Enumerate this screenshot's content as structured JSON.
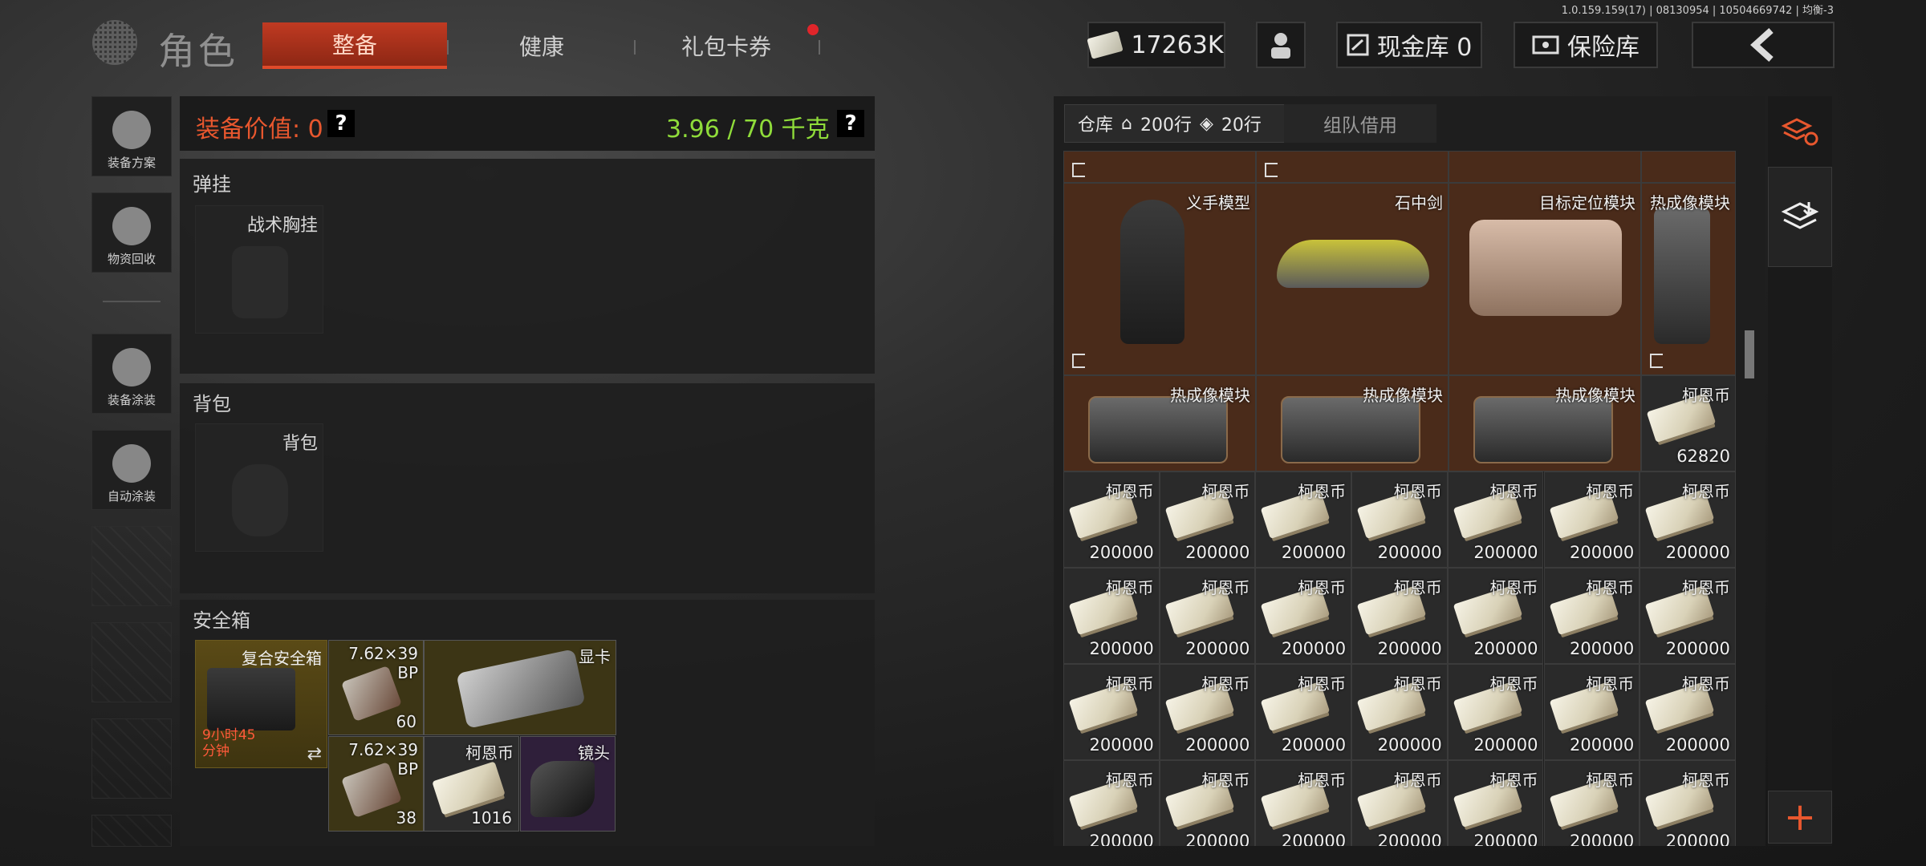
{
  "version": "1.0.159.159(17) | 08130954 | 10504669742 | 均衡-3",
  "title": "角色",
  "tabs": {
    "gear": "整备",
    "health": "健康",
    "gift": "礼包卡券"
  },
  "top": {
    "currency": "17263K",
    "cash_vault": "现金库 0",
    "insurance": "保险库"
  },
  "sidebar": {
    "loadout": "装备方案",
    "recycle": "物资回收",
    "skin": "装备涂装",
    "autopaint": "自动涂装"
  },
  "equip": {
    "value_label": "装备价值: 0",
    "weight": "3.96 / 70 千克",
    "help": "?"
  },
  "sections": {
    "rig": {
      "title": "弹挂",
      "slot": "战术胸挂"
    },
    "backpack": {
      "title": "背包",
      "slot": "背包"
    },
    "safebox": {
      "title": "安全箱",
      "box_name": "复合安全箱",
      "timer": "9小时45分钟",
      "items": [
        {
          "name": "7.62×39 BP",
          "count": "60"
        },
        {
          "name": "显卡",
          "count": ""
        },
        {
          "name": "7.62×39 BP",
          "count": "38"
        },
        {
          "name": "柯恩币",
          "count": "1016"
        },
        {
          "name": "镜头",
          "count": ""
        }
      ]
    }
  },
  "warehouse": {
    "tab": "仓库",
    "rows_home": "200行",
    "rows_ticket": "20行",
    "team_tab": "组队借用",
    "big_items": [
      {
        "name": "义手模型"
      },
      {
        "name": "石中剑"
      },
      {
        "name": "目标定位模块"
      },
      {
        "name": "热成像模块"
      }
    ],
    "thermal_items": [
      {
        "name": "热成像模块"
      },
      {
        "name": "热成像模块"
      },
      {
        "name": "热成像模块"
      }
    ],
    "coin_top": {
      "name": "柯恩币",
      "count": "62820"
    },
    "coin_name": "柯恩币",
    "coin_count": "200000"
  }
}
